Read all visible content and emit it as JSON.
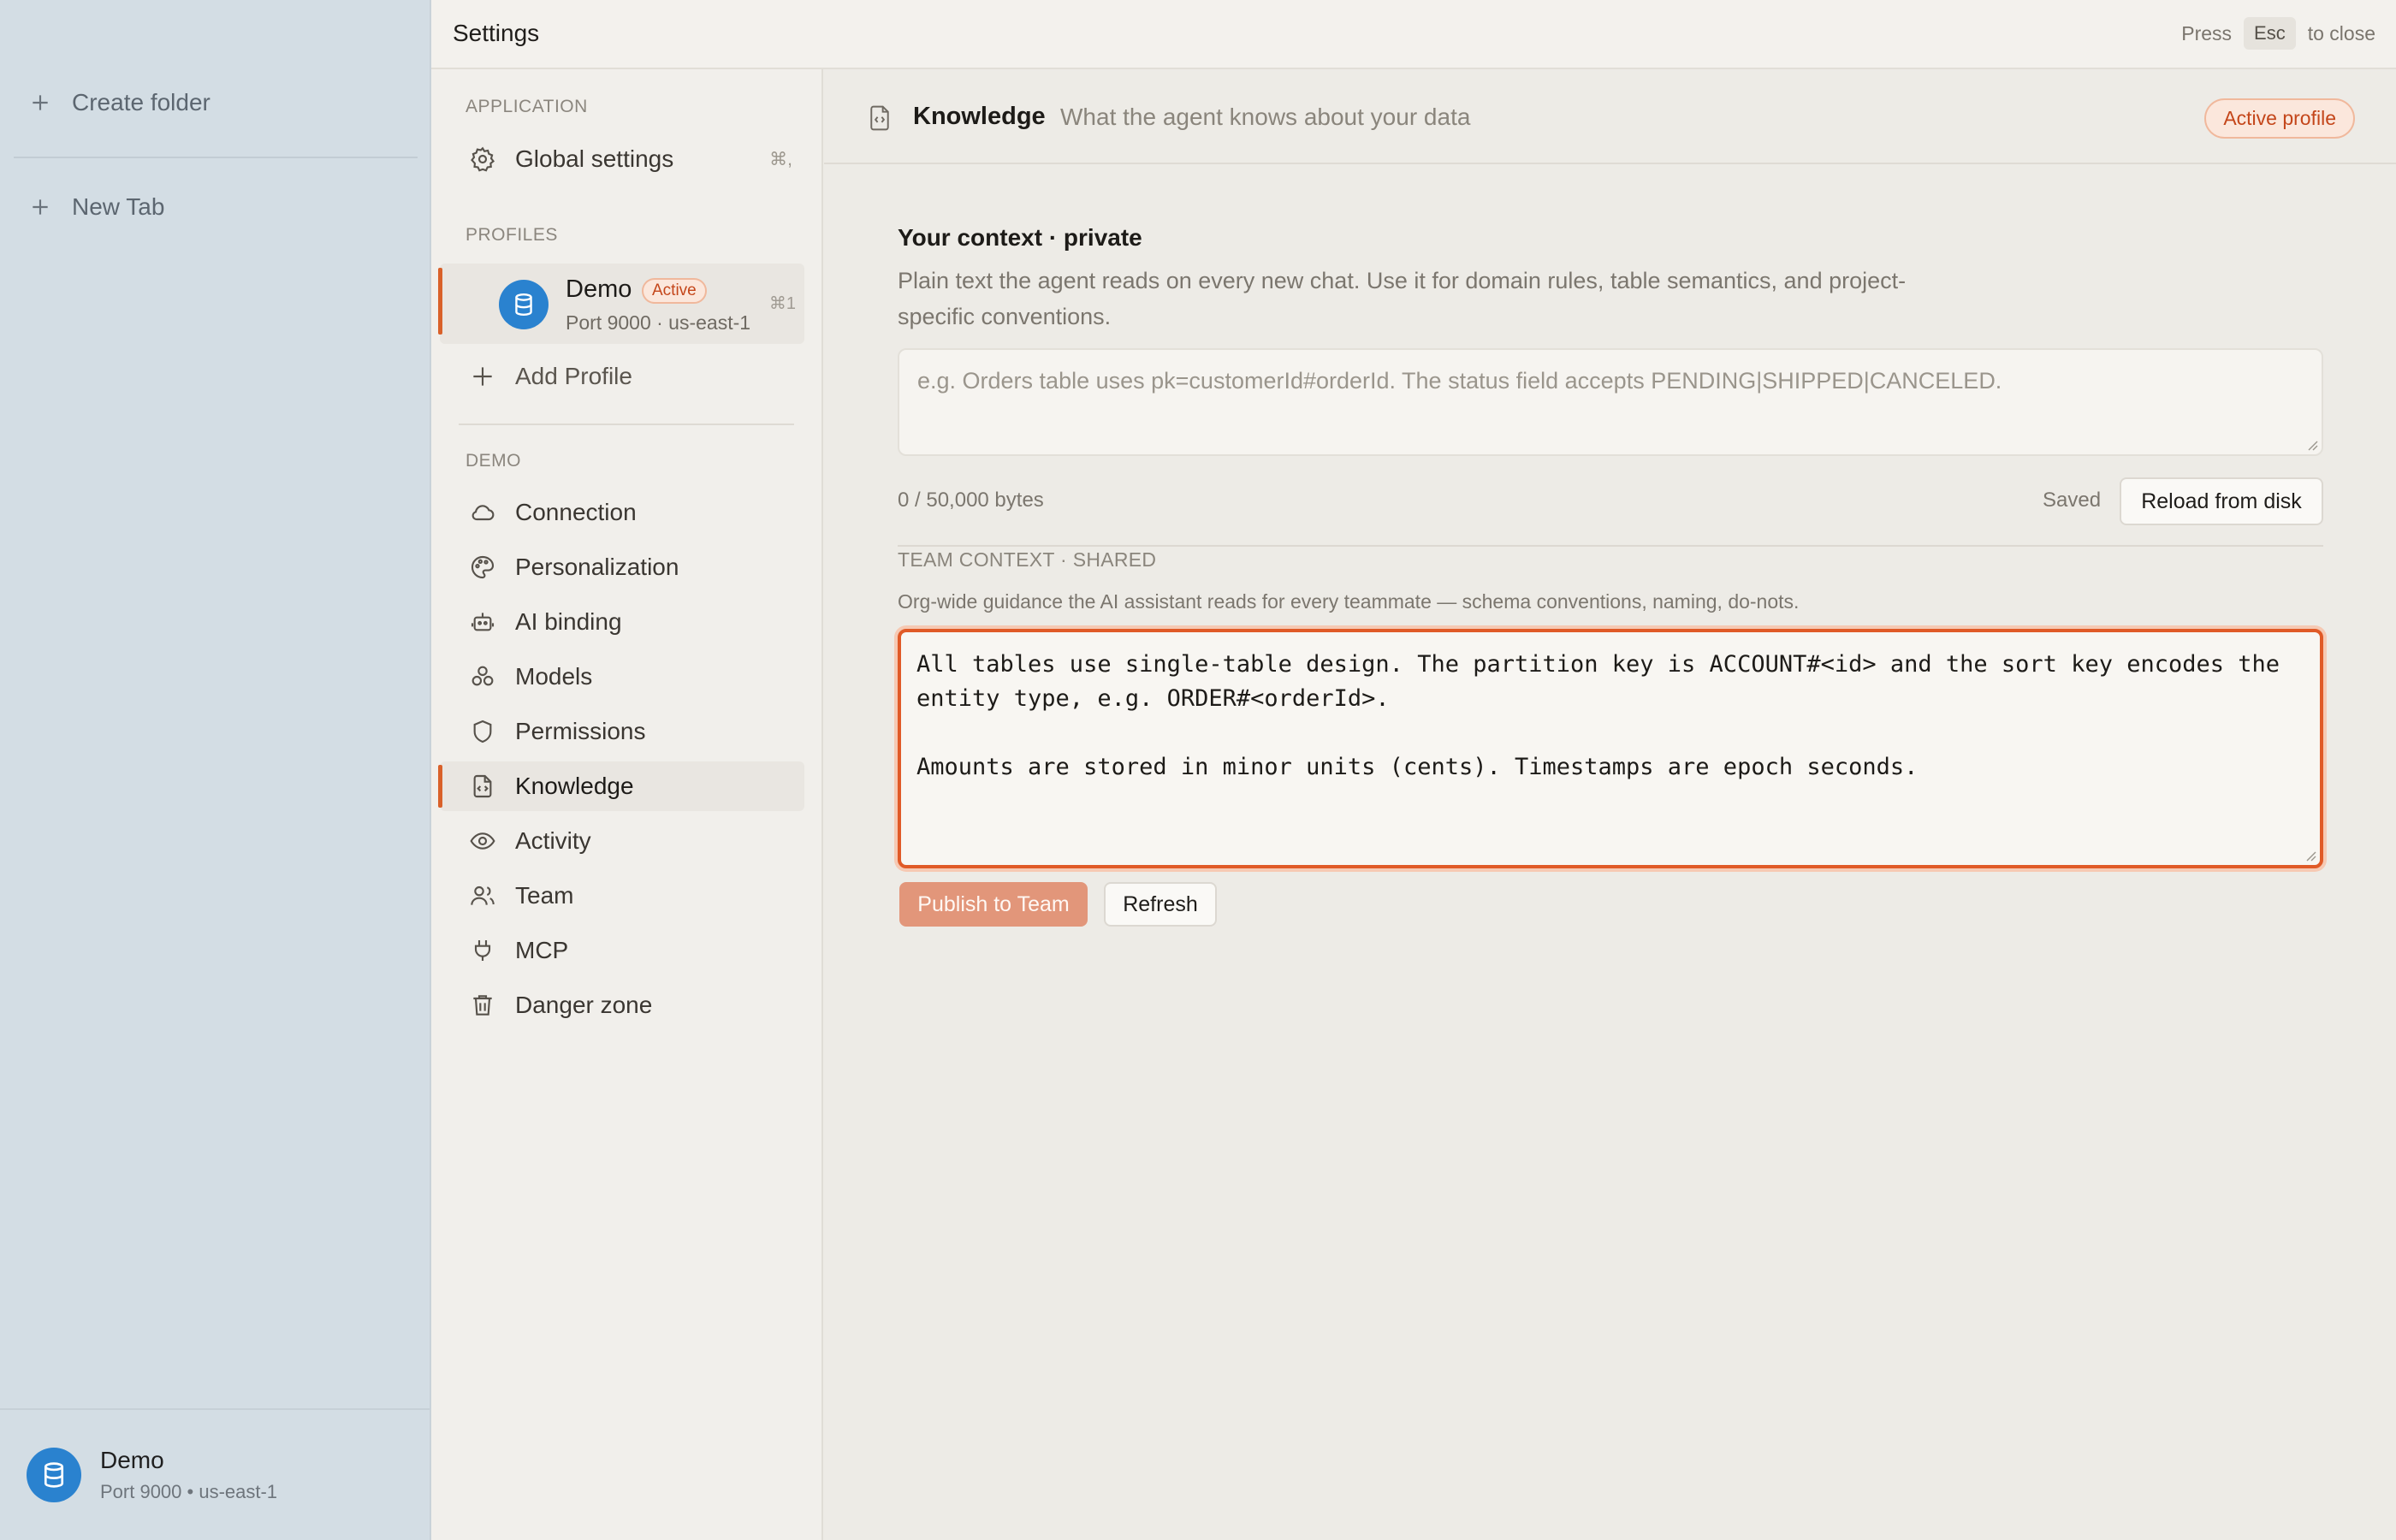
{
  "app_sidebar": {
    "create_folder": "Create folder",
    "new_tab": "New Tab",
    "footer": {
      "name": "Demo",
      "sub": "Port 9000 • us-east-1"
    }
  },
  "topbar": {
    "title": "Settings",
    "hint_press": "Press",
    "hint_key": "Esc",
    "hint_close": "to close"
  },
  "nav": {
    "application_heading": "APPLICATION",
    "global_settings": {
      "label": "Global settings",
      "shortcut": "⌘,"
    },
    "profiles_heading": "PROFILES",
    "profile": {
      "name": "Demo",
      "badge": "Active",
      "sub": "Port 9000 · us-east-1",
      "shortcut": "⌘1"
    },
    "add_profile": "Add Profile",
    "demo_heading": "DEMO",
    "items": [
      {
        "label": "Connection",
        "icon": "cloud-icon"
      },
      {
        "label": "Personalization",
        "icon": "palette-icon"
      },
      {
        "label": "AI binding",
        "icon": "robot-icon"
      },
      {
        "label": "Models",
        "icon": "models-icon"
      },
      {
        "label": "Permissions",
        "icon": "shield-icon"
      },
      {
        "label": "Knowledge",
        "icon": "document-code-icon"
      },
      {
        "label": "Activity",
        "icon": "eye-icon"
      },
      {
        "label": "Team",
        "icon": "users-icon"
      },
      {
        "label": "MCP",
        "icon": "plug-icon"
      },
      {
        "label": "Danger zone",
        "icon": "trash-icon"
      }
    ],
    "selected": "Knowledge"
  },
  "page": {
    "title": "Knowledge",
    "subtitle": "What the agent knows about your data",
    "badge": "Active profile",
    "private": {
      "title": "Your context · private",
      "description": "Plain text the agent reads on every new chat. Use it for domain rules, table semantics, and project-specific conventions.",
      "placeholder": "e.g. Orders table uses pk=customerId#orderId. The status field accepts PENDING|SHIPPED|CANCELED.",
      "value": "",
      "bytes": "0 / 50,000 bytes",
      "status": "Saved",
      "reload_label": "Reload from disk"
    },
    "team": {
      "title": "TEAM CONTEXT · SHARED",
      "description": "Org-wide guidance the AI assistant reads for every teammate — schema conventions, naming, do-nots.",
      "value": "All tables use single-table design. The partition key is ACCOUNT#<id> and the sort key encodes the entity type, e.g. ORDER#<orderId>.\n\nAmounts are stored in minor units (cents). Timestamps are epoch seconds.",
      "publish_label": "Publish to Team",
      "refresh_label": "Refresh"
    }
  },
  "colors": {
    "accent": "#e05a27",
    "avatar": "#2a82cf",
    "sidebar": "#d3dde4"
  }
}
